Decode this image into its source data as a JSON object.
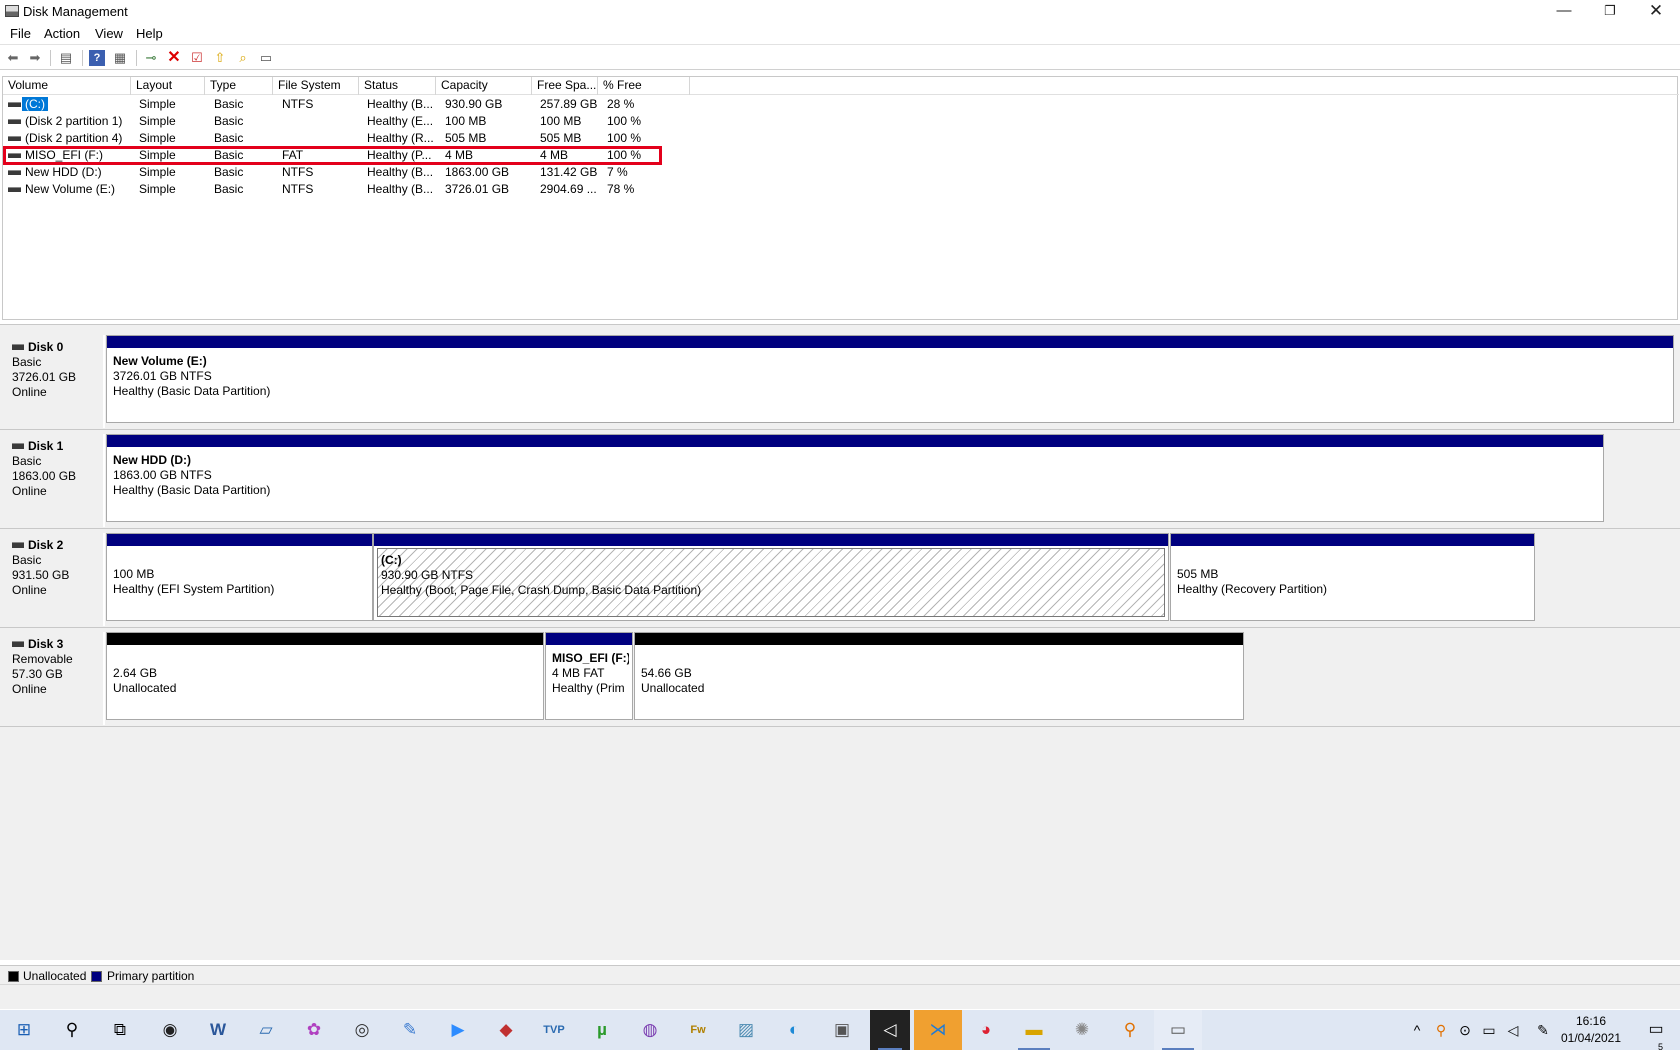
{
  "window": {
    "title": "Disk Management",
    "minimize": "—",
    "maximize": "❐",
    "close": "✕"
  },
  "menu": [
    "File",
    "Action",
    "View",
    "Help"
  ],
  "toolbar_icons": [
    "back-arrow-icon",
    "forward-arrow-icon",
    "show-hide-console-tree-icon",
    "help-icon",
    "properties-icon",
    "connect-icon",
    "delete-icon",
    "check-icon",
    "import-icon",
    "search-icon",
    "console-icon"
  ],
  "columns": [
    "Volume",
    "Layout",
    "Type",
    "File System",
    "Status",
    "Capacity",
    "Free Spa...",
    "% Free"
  ],
  "volumes": [
    {
      "volume": "(C:)",
      "layout": "Simple",
      "type": "Basic",
      "fs": "NTFS",
      "status": "Healthy (B...",
      "capacity": "930.90 GB",
      "free": "257.89 GB",
      "pct": "28 %"
    },
    {
      "volume": "(Disk 2 partition 1)",
      "layout": "Simple",
      "type": "Basic",
      "fs": "",
      "status": "Healthy (E...",
      "capacity": "100 MB",
      "free": "100 MB",
      "pct": "100 %"
    },
    {
      "volume": "(Disk 2 partition 4)",
      "layout": "Simple",
      "type": "Basic",
      "fs": "",
      "status": "Healthy (R...",
      "capacity": "505 MB",
      "free": "505 MB",
      "pct": "100 %"
    },
    {
      "volume": "MISO_EFI (F:)",
      "layout": "Simple",
      "type": "Basic",
      "fs": "FAT",
      "status": "Healthy (P...",
      "capacity": "4 MB",
      "free": "4 MB",
      "pct": "100 %"
    },
    {
      "volume": "New HDD (D:)",
      "layout": "Simple",
      "type": "Basic",
      "fs": "NTFS",
      "status": "Healthy (B...",
      "capacity": "1863.00 GB",
      "free": "131.42 GB",
      "pct": "7 %"
    },
    {
      "volume": "New Volume (E:)",
      "layout": "Simple",
      "type": "Basic",
      "fs": "NTFS",
      "status": "Healthy (B...",
      "capacity": "3726.01 GB",
      "free": "2904.69 ...",
      "pct": "78 %"
    }
  ],
  "disks": [
    {
      "name": "Disk 0",
      "kind": "Basic",
      "size": "3726.01 GB",
      "state": "Online",
      "partitions": [
        {
          "title": "New Volume  (E:)",
          "line2": "3726.01 GB NTFS",
          "line3": "Healthy (Basic Data Partition)",
          "bar": "primary"
        }
      ]
    },
    {
      "name": "Disk 1",
      "kind": "Basic",
      "size": "1863.00 GB",
      "state": "Online",
      "partitions": [
        {
          "title": "New HDD  (D:)",
          "line2": "1863.00 GB NTFS",
          "line3": "Healthy (Basic Data Partition)",
          "bar": "primary"
        }
      ]
    },
    {
      "name": "Disk 2",
      "kind": "Basic",
      "size": "931.50 GB",
      "state": "Online",
      "partitions": [
        {
          "title": "",
          "line2": "100 MB",
          "line3": "Healthy (EFI System Partition)",
          "bar": "primary"
        },
        {
          "title": "(C:)",
          "line2": "930.90 GB NTFS",
          "line3": "Healthy (Boot, Page File, Crash Dump, Basic Data Partition)",
          "bar": "primary",
          "selected": true
        },
        {
          "title": "",
          "line2": "505 MB",
          "line3": "Healthy (Recovery Partition)",
          "bar": "primary"
        }
      ]
    },
    {
      "name": "Disk 3",
      "kind": "Removable",
      "size": "57.30 GB",
      "state": "Online",
      "partitions": [
        {
          "title": "",
          "line2": "2.64 GB",
          "line3": "Unallocated",
          "bar": "unallocated"
        },
        {
          "title": "MISO_EFI  (F:)",
          "line2": "4 MB FAT",
          "line3": "Healthy (Prim",
          "bar": "primary"
        },
        {
          "title": "",
          "line2": "54.66 GB",
          "line3": "Unallocated",
          "bar": "unallocated"
        }
      ]
    }
  ],
  "legend": {
    "unallocated": "Unallocated",
    "primary": "Primary partition",
    "unallocated_color": "#000000",
    "primary_color": "#00007f"
  },
  "taskbar": {
    "apps": [
      "windows-start-icon",
      "search-icon",
      "task-view-icon",
      "obs-icon",
      "word-icon",
      "laptop-app-icon",
      "paint-app-icon",
      "camera-app-icon",
      "feather-app-icon",
      "zoom-icon",
      "git-app-icon",
      "tvp-app-icon",
      "utorrent-icon",
      "tor-icon",
      "fireworks-icon",
      "notes-app-icon",
      "edge-icon",
      "window-app-icon",
      "unity-icon",
      "vscode-icon",
      "chrome-icon",
      "file-explorer-icon",
      "settings-app-icon",
      "magnifier-app-icon",
      "disk-management-icon"
    ],
    "time": "16:16",
    "date": "01/04/2021",
    "notification_count": "5"
  }
}
